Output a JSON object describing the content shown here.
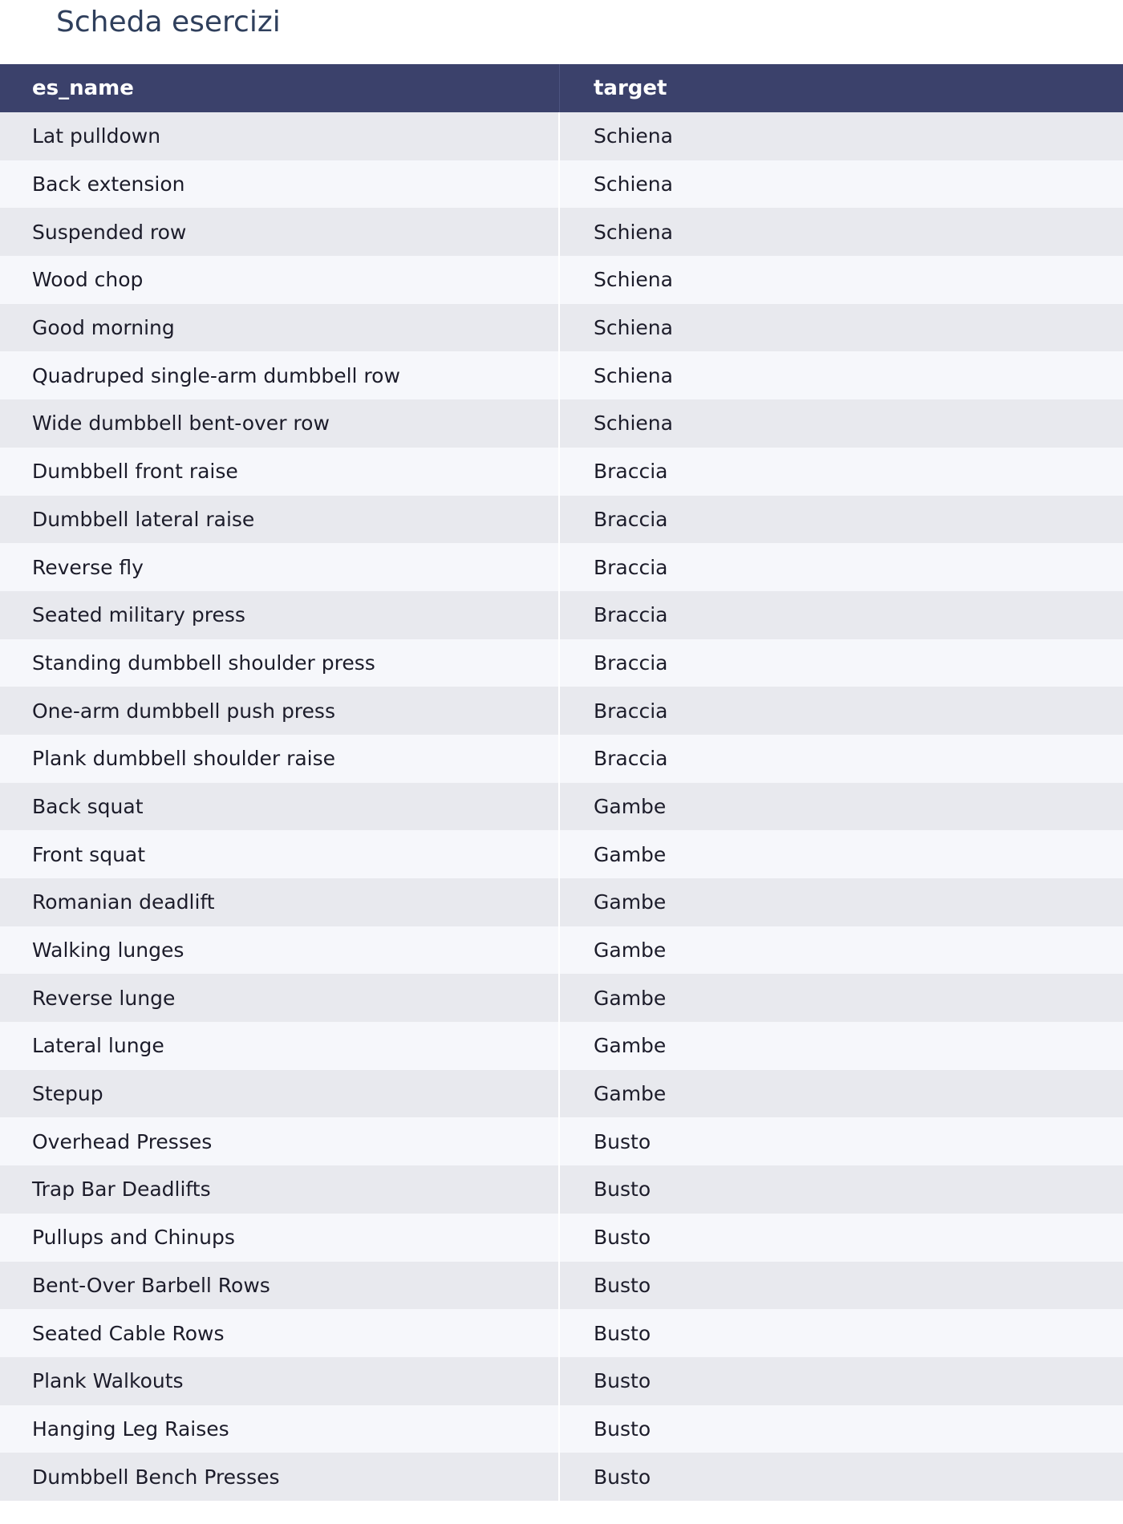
{
  "page": {
    "title": "Scheda esercizi"
  },
  "table": {
    "columns": [
      "es_name",
      "target"
    ],
    "rows": [
      {
        "es_name": "Lat pulldown",
        "target": "Schiena"
      },
      {
        "es_name": "Back extension",
        "target": "Schiena"
      },
      {
        "es_name": "Suspended row",
        "target": "Schiena"
      },
      {
        "es_name": "Wood chop",
        "target": "Schiena"
      },
      {
        "es_name": "Good morning",
        "target": "Schiena"
      },
      {
        "es_name": "Quadruped single-arm dumbbell row",
        "target": "Schiena"
      },
      {
        "es_name": "Wide dumbbell bent-over row",
        "target": "Schiena"
      },
      {
        "es_name": "Dumbbell front raise",
        "target": "Braccia"
      },
      {
        "es_name": "Dumbbell lateral raise",
        "target": "Braccia"
      },
      {
        "es_name": "Reverse fly",
        "target": "Braccia"
      },
      {
        "es_name": "Seated military press",
        "target": "Braccia"
      },
      {
        "es_name": "Standing dumbbell shoulder press",
        "target": "Braccia"
      },
      {
        "es_name": "One-arm dumbbell push press",
        "target": "Braccia"
      },
      {
        "es_name": "Plank dumbbell shoulder raise",
        "target": "Braccia"
      },
      {
        "es_name": "Back squat",
        "target": "Gambe"
      },
      {
        "es_name": "Front squat",
        "target": "Gambe"
      },
      {
        "es_name": "Romanian deadlift",
        "target": "Gambe"
      },
      {
        "es_name": "Walking lunges",
        "target": "Gambe"
      },
      {
        "es_name": "Reverse lunge",
        "target": "Gambe"
      },
      {
        "es_name": "Lateral lunge",
        "target": "Gambe"
      },
      {
        "es_name": "Stepup",
        "target": "Gambe"
      },
      {
        "es_name": "Overhead Presses",
        "target": "Busto"
      },
      {
        "es_name": "Trap Bar Deadlifts",
        "target": "Busto"
      },
      {
        "es_name": "Pullups and Chinups",
        "target": "Busto"
      },
      {
        "es_name": "Bent-Over Barbell Rows",
        "target": "Busto"
      },
      {
        "es_name": "Seated Cable Rows",
        "target": "Busto"
      },
      {
        "es_name": "Plank Walkouts",
        "target": "Busto"
      },
      {
        "es_name": "Hanging Leg Raises",
        "target": "Busto"
      },
      {
        "es_name": "Dumbbell Bench Presses",
        "target": "Busto"
      }
    ]
  },
  "colors": {
    "header_bg": "#3b416b",
    "row_odd_bg": "#e8e9ee",
    "row_even_bg": "#f6f7fb",
    "title_color": "#2f3f5c"
  }
}
